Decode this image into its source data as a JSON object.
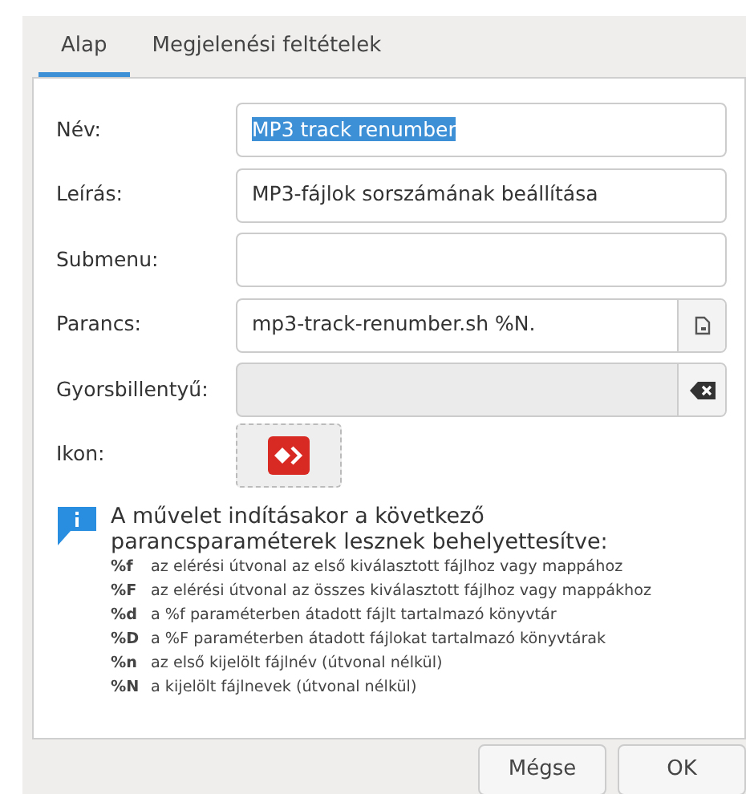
{
  "tabs": [
    {
      "label": "Alap",
      "selected": true
    },
    {
      "label": "Megjelenési feltételek",
      "selected": false
    }
  ],
  "fields": [
    {
      "kind": "text",
      "label": "Név:",
      "value": "MP3 track renumber",
      "text_selected": true
    },
    {
      "kind": "text",
      "label": "Leírás:",
      "value": "MP3-fájlok sorszámának beállítása",
      "text_selected": false
    },
    {
      "kind": "text",
      "label": "Submenu:",
      "text_selected": false
    },
    {
      "kind": "file",
      "label": "Parancs:",
      "value": "mp3-track-renumber.sh %N.",
      "text_selected": false
    },
    {
      "kind": "shortcut",
      "label": "Gyorsbillentyű:",
      "text_selected": false
    },
    {
      "kind": "icon",
      "label": "Ikon:"
    }
  ],
  "info": {
    "heading": "A művelet indításakor a következő parancsparaméterek lesznek behelyettesítve:",
    "params": [
      {
        "code": "%f",
        "description": "az elérési útvonal az első kiválasztott fájlhoz vagy mappához"
      },
      {
        "code": "%F",
        "description": "az elérési útvonal az összes kiválasztott fájlhoz vagy mappákhoz"
      },
      {
        "code": "%d",
        "description": "a %f paraméterben átadott fájlt tartalmazó könyvtár"
      },
      {
        "code": "%D",
        "description": "a %F paraméterben átadott fájlokat tartalmazó könyvtárak"
      },
      {
        "code": "%n",
        "description": "az első kijelölt fájlnév (útvonal nélkül)"
      },
      {
        "code": "%N",
        "description": "a kijelölt fájlnevek (útvonal nélkül)"
      }
    ]
  },
  "buttons": [
    "Mégse",
    "OK"
  ]
}
